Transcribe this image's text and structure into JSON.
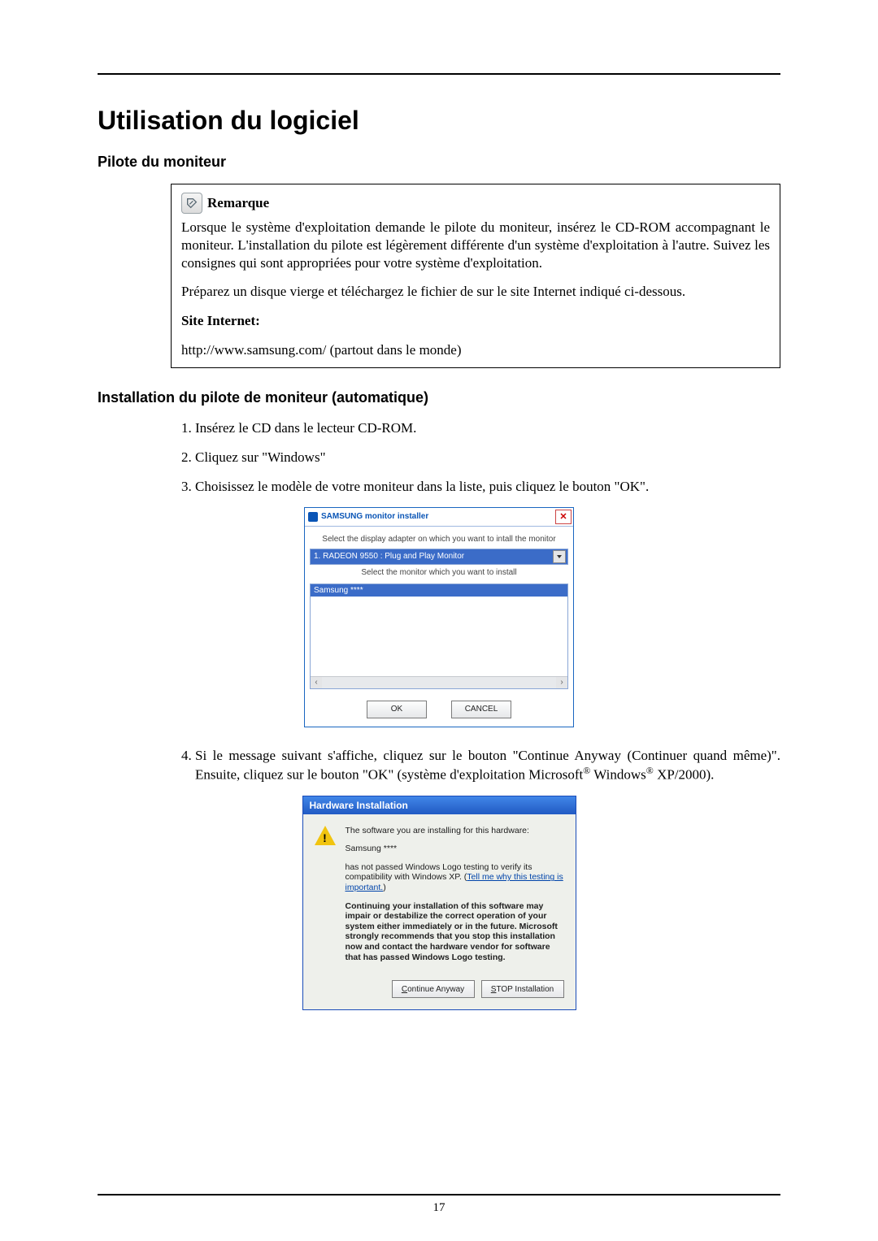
{
  "page_number": "17",
  "h1": "Utilisation du logiciel",
  "h2_driver": "Pilote du moniteur",
  "note": {
    "title": "Remarque",
    "p1": "Lorsque le système d'exploitation demande le pilote du moniteur, insérez le CD-ROM accompagnant le moniteur. L'installation du pilote est légèrement différente d'un système d'exploitation à l'autre. Suivez les consignes qui sont appropriées pour votre système d'exploitation.",
    "p2": "Préparez un disque vierge et téléchargez le fichier de sur le site Internet indiqué ci-dessous.",
    "site_label": "Site Internet:",
    "site_url": "http://www.samsung.com/ (partout dans le monde)"
  },
  "h2_install": "Installation du pilote de moniteur (automatique)",
  "steps": {
    "s1": "Insérez le CD dans le lecteur CD-ROM.",
    "s2": "Cliquez sur \"Windows\"",
    "s3": "Choisissez le modèle de votre moniteur dans la liste, puis cliquez le bouton \"OK\".",
    "s4a": "Si le message suivant s'affiche, cliquez sur le bouton \"Continue Anyway (Continuer quand même)\". Ensuite, cliquez sur le bouton \"OK\" (système d'exploitation Microsoft",
    "s4b": " Windows",
    "s4c": " XP/2000)."
  },
  "installer": {
    "title": "SAMSUNG monitor installer",
    "label_adapter": "Select the display adapter on which you want to intall the monitor",
    "dropdown": "1. RADEON 9550 : Plug and Play Monitor",
    "label_monitor": "Select the monitor which you want to install",
    "selected_item": "Samsung ****",
    "ok": "OK",
    "cancel": "CANCEL"
  },
  "hwdlg": {
    "title": "Hardware Installation",
    "line1": "The software you are installing for this hardware:",
    "device": "Samsung ****",
    "line2a": "has not passed Windows Logo testing to verify its compatibility with Windows XP. (",
    "link": "Tell me why this testing is important.",
    "line2b": ")",
    "warn": "Continuing your installation of this software may impair or destabilize the correct operation of your system either immediately or in the future. Microsoft strongly recommends that you stop this installation now and contact the hardware vendor for software that has passed Windows Logo testing.",
    "continue": "Continue Anyway",
    "stop": "STOP Installation"
  }
}
